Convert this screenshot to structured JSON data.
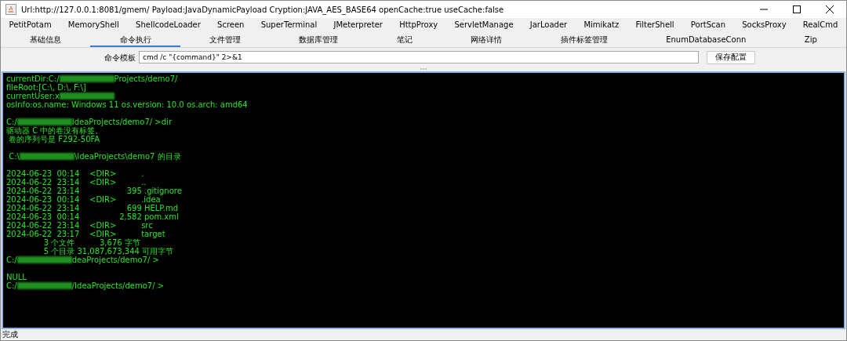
{
  "window": {
    "title": "Url:http://127.0.0.1:8081/gmem/ Payload:JavaDynamicPayload Cryption:JAVA_AES_BASE64 openCache:true useCache:false"
  },
  "plugin_tabs": [
    {
      "label": "PetitPotam",
      "selected": false
    },
    {
      "label": "MemoryShell",
      "selected": false
    },
    {
      "label": "ShellcodeLoader",
      "selected": false
    },
    {
      "label": "Screen",
      "selected": false
    },
    {
      "label": "SuperTerminal",
      "selected": false
    },
    {
      "label": "JMeterpreter",
      "selected": false
    },
    {
      "label": "HttpProxy",
      "selected": false
    },
    {
      "label": "ServletManage",
      "selected": false
    },
    {
      "label": "JarLoader",
      "selected": false
    },
    {
      "label": "Mimikatz",
      "selected": false
    },
    {
      "label": "FilterShell",
      "selected": false
    },
    {
      "label": "PortScan",
      "selected": false
    },
    {
      "label": "SocksProxy",
      "selected": false
    },
    {
      "label": "RealCmd",
      "selected": false
    }
  ],
  "main_tabs": [
    {
      "label": "基础信息",
      "selected": false
    },
    {
      "label": "命令执行",
      "selected": true
    },
    {
      "label": "文件管理",
      "selected": false
    },
    {
      "label": "数据库管理",
      "selected": false
    },
    {
      "label": "笔记",
      "selected": false
    },
    {
      "label": "网络详情",
      "selected": false
    },
    {
      "label": "插件标签管理",
      "selected": false
    },
    {
      "label": "EnumDatabaseConn",
      "selected": false
    },
    {
      "label": "Zip",
      "selected": false
    }
  ],
  "command_template": {
    "label": "命令模板",
    "value": "cmd /c \"{command}\" 2>&1",
    "save_button": "保存配置"
  },
  "terminal_lines": [
    [
      {
        "kind": "text",
        "text": "currentDir:C:/"
      },
      {
        "kind": "redaction"
      },
      {
        "kind": "text",
        "text": "Projects/demo7/"
      }
    ],
    [
      {
        "kind": "text",
        "text": "fileRoot:[C:\\, D:\\, F:\\]"
      }
    ],
    [
      {
        "kind": "text",
        "text": "currentUser:x"
      },
      {
        "kind": "redaction"
      }
    ],
    [
      {
        "kind": "text",
        "text": "osInfo:os.name: Windows 11 os.version: 10.0 os.arch: amd64"
      }
    ],
    [
      {
        "kind": "blank"
      }
    ],
    [
      {
        "kind": "text",
        "text": "C:/"
      },
      {
        "kind": "redaction"
      },
      {
        "kind": "text",
        "text": "IdeaProjects/demo7/ >dir"
      }
    ],
    [
      {
        "kind": "text",
        "text": "驱动器 C 中的卷没有标签。"
      }
    ],
    [
      {
        "kind": "text",
        "text": " 卷的序列号是 F292-50FA"
      }
    ],
    [
      {
        "kind": "blank"
      }
    ],
    [
      {
        "kind": "text",
        "text": " C:\\"
      },
      {
        "kind": "redaction"
      },
      {
        "kind": "text",
        "text": "\\IdeaProjects\\demo7 的目录"
      }
    ],
    [
      {
        "kind": "blank"
      }
    ],
    [
      {
        "kind": "text",
        "text": "2024-06-23  00:14    <DIR>          ."
      }
    ],
    [
      {
        "kind": "text",
        "text": "2024-06-22  23:14    <DIR>          .."
      }
    ],
    [
      {
        "kind": "text",
        "text": "2024-06-22  23:14                   395 .gitignore"
      }
    ],
    [
      {
        "kind": "text",
        "text": "2024-06-23  00:14    <DIR>          .idea"
      }
    ],
    [
      {
        "kind": "text",
        "text": "2024-06-22  23:14                   699 HELP.md"
      }
    ],
    [
      {
        "kind": "text",
        "text": "2024-06-23  00:14                2,582 pom.xml"
      }
    ],
    [
      {
        "kind": "text",
        "text": "2024-06-22  23:14    <DIR>          src"
      }
    ],
    [
      {
        "kind": "text",
        "text": "2024-06-22  23:17    <DIR>          target"
      }
    ],
    [
      {
        "kind": "text",
        "text": "               3 个文件          3,676 字节"
      }
    ],
    [
      {
        "kind": "text",
        "text": "               5 个目录 31,087,673,344 可用字节"
      }
    ],
    [
      {
        "kind": "text",
        "text": "C:/"
      },
      {
        "kind": "redaction"
      },
      {
        "kind": "text",
        "text": "deaProjects/demo7/ >"
      }
    ],
    [
      {
        "kind": "blank"
      }
    ],
    [
      {
        "kind": "text",
        "text": "NULL"
      }
    ],
    [
      {
        "kind": "text",
        "text": "C:/"
      },
      {
        "kind": "redaction"
      },
      {
        "kind": "text",
        "text": "/IdeaProjects/demo7/ >"
      }
    ]
  ],
  "status_bar": "完成"
}
